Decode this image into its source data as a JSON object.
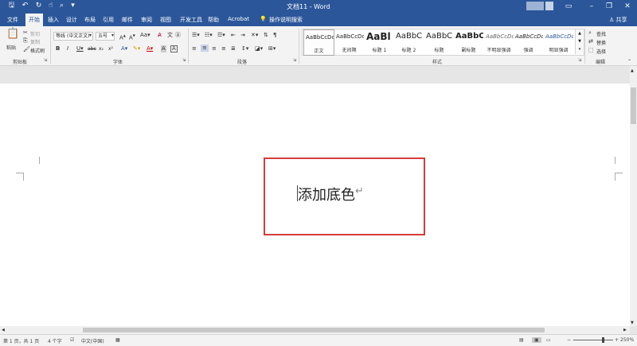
{
  "titlebar": {
    "title": "文档11 - Word",
    "qat_icons": [
      "save-icon",
      "undo-icon",
      "redo-icon",
      "touch-mode-icon",
      "print-preview-icon",
      "customize-qat-icon"
    ],
    "window_icons": [
      "ribbon-display-icon",
      "minimize-icon",
      "restore-icon",
      "close-icon"
    ]
  },
  "tabs": {
    "items": [
      "文件",
      "开始",
      "插入",
      "设计",
      "布局",
      "引用",
      "邮件",
      "审阅",
      "视图",
      "开发工具",
      "帮助",
      "Acrobat"
    ],
    "tellme": "操作说明搜索",
    "share": "共享"
  },
  "clipboard": {
    "paste": "粘贴",
    "cut": "剪切",
    "copy": "复制",
    "format_painter": "格式刷",
    "label": "剪贴板"
  },
  "font": {
    "name": "等线 (中文正文)",
    "size": "五号",
    "label": "字体"
  },
  "paragraph": {
    "label": "段落"
  },
  "styles": {
    "label": "样式",
    "items": [
      {
        "sample": "AaBbCcDd",
        "name": "正文"
      },
      {
        "sample": "AaBbCcDd",
        "name": "无间隔"
      },
      {
        "sample": "AaBl",
        "name": "标题 1"
      },
      {
        "sample": "AaBbC",
        "name": "标题 2"
      },
      {
        "sample": "AaBbC",
        "name": "标题"
      },
      {
        "sample": "AaBbC",
        "name": "副标题"
      },
      {
        "sample": "AaBbCcDd",
        "name": "不明显强调"
      },
      {
        "sample": "AaBbCcDd",
        "name": "强调"
      },
      {
        "sample": "AaBbCcDd",
        "name": "明显强调"
      }
    ]
  },
  "editing": {
    "find": "查找",
    "replace": "替换",
    "select": "选择",
    "label": "编辑"
  },
  "document": {
    "text": "添加底色",
    "highlight_color": "#d63b3b"
  },
  "statusbar": {
    "page": "第 1 页，共 1 页",
    "words": "4 个字",
    "language": "中文(中国)",
    "zoom": "250%"
  },
  "colors": {
    "accent": "#2b579a"
  }
}
